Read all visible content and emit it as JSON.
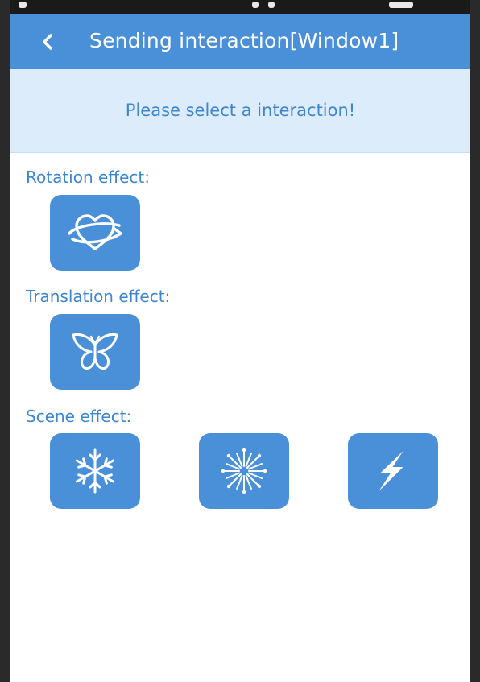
{
  "header": {
    "back_icon": "chevron-left-icon",
    "title": "Sending interaction[Window1]"
  },
  "notice": {
    "text": "Please select a interaction!"
  },
  "sections": {
    "rotation": {
      "label": "Rotation effect:",
      "items": [
        {
          "icon": "heart-orbit-icon"
        }
      ]
    },
    "translation": {
      "label": "Translation effect:",
      "items": [
        {
          "icon": "butterfly-icon"
        }
      ]
    },
    "scene": {
      "label": "Scene effect:",
      "items": [
        {
          "icon": "snowflake-icon"
        },
        {
          "icon": "firework-icon"
        },
        {
          "icon": "lightning-icon"
        }
      ]
    }
  },
  "colors": {
    "app_bar": "#4a90d9",
    "notice_bg": "#dcecfb",
    "accent_text": "#3d86d0",
    "button": "#4a90d9"
  }
}
